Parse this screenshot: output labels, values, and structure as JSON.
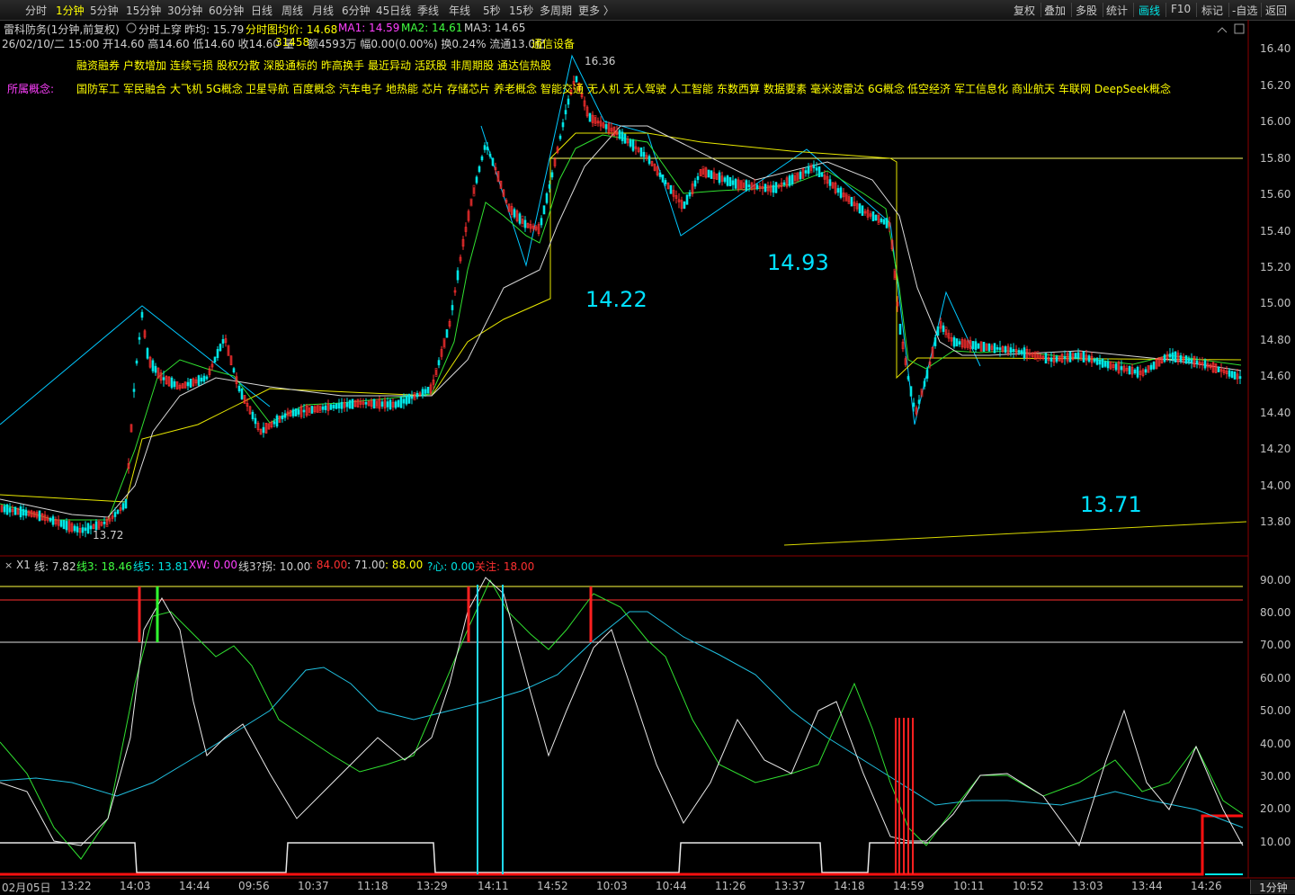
{
  "toolbar": {
    "timeframes": [
      "分时",
      "1分钟",
      "5分钟",
      "15分钟",
      "30分钟",
      "60分钟",
      "日线",
      "周线",
      "月线",
      "6分钟",
      "45日线",
      "季线",
      "年线",
      "5秒",
      "15秒",
      "多周期",
      "更多 〉"
    ],
    "active_timeframe": "1分钟",
    "right_buttons": [
      "复权",
      "叠加",
      "多股",
      "统计",
      "画线",
      "F10",
      "标记",
      "-自选",
      "返回"
    ],
    "active_right": "画线"
  },
  "header": {
    "stock_name": "雷科防务(1分钟,前复权)",
    "mode": "分时上穿",
    "prev_close_label": "昨均: 15.79",
    "avg_label": "分时图均价: 14.68",
    "ma1_label": "MA1: 14.59",
    "ma2_label": "MA2: 14.61",
    "ma3_label": "MA3: 14.65",
    "quote_line": "26/02/10/二 15:00 开14.60 高14.60 低14.60 收14.60 量",
    "volume": "31458",
    "quote_line2": "额4593万 幅0.00(0.00%) 换0.24% 流通13.0亿",
    "sector": "通信设备"
  },
  "tags": {
    "line1": [
      "融资融券",
      "户数增加",
      "连续亏损",
      "股权分散",
      "深股通标的",
      "昨高换手",
      "最近异动",
      "活跃股",
      "非周期股",
      "通达信热股"
    ],
    "concepts_label": "所属概念:",
    "concepts": [
      "国防军工",
      "军民融合",
      "大飞机",
      "5G概念",
      "卫星导航",
      "百度概念",
      "汽车电子",
      "地热能",
      "芯片",
      "存储芯片",
      "养老概念",
      "智能交通",
      "无人机",
      "无人驾驶",
      "人工智能",
      "东数西算",
      "数据要素",
      "毫米波雷达",
      "6G概念",
      "低空经济",
      "军工信息化",
      "商业航天",
      "车联网",
      "DeepSeek概念"
    ]
  },
  "annotations": {
    "price_high": "16.36",
    "price_low": "13.72",
    "a1": "14.22",
    "a2": "14.93",
    "a3": "13.71"
  },
  "price_axis": [
    "16.40",
    "16.20",
    "16.00",
    "15.80",
    "15.60",
    "15.40",
    "15.20",
    "15.00",
    "14.80",
    "14.60",
    "14.40",
    "14.20",
    "14.00",
    "13.80"
  ],
  "indicator": {
    "name": "X1",
    "line_label": "线: 7.82",
    "line3_label": "线3: 18.46",
    "line5_label": "线5: 13.81",
    "xw_label": "XW: 0.00",
    "line3b_label": "线3?拐: 10.00",
    "v84": ": 84.00",
    "v71": ": 71.00",
    "v88": ": 88.00",
    "xin_label": "?心: 0.00",
    "focus_label": "关注: 18.00",
    "axis": [
      "90.00",
      "80.00",
      "70.00",
      "60.00",
      "50.00",
      "40.00",
      "30.00",
      "20.00",
      "10.00"
    ]
  },
  "time_axis": [
    "02月05日",
    "13:22",
    "14:03",
    "14:44",
    "09:56",
    "10:37",
    "11:18",
    "13:29",
    "14:11",
    "14:52",
    "10:03",
    "10:44",
    "11:26",
    "13:37",
    "14:18",
    "14:59",
    "10:11",
    "10:52",
    "13:03",
    "13:44",
    "14:26"
  ],
  "period_button": "1分钟",
  "colors": {
    "up": "#ff3030",
    "down": "#00e6e6",
    "ma_yellow": "#ffff00",
    "ma_green": "#40ff40",
    "ma_white": "#e0e0e0"
  }
}
